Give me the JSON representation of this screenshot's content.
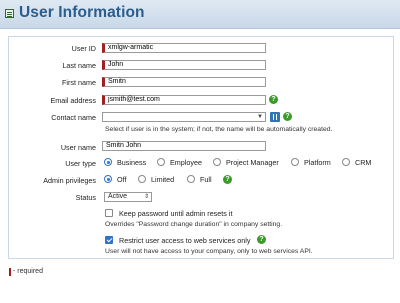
{
  "header": {
    "title": "User Information"
  },
  "form": {
    "user_id": {
      "label": "User ID",
      "value": "xmlgw-armatic"
    },
    "last_name": {
      "label": "Last name",
      "value": "John"
    },
    "first_name": {
      "label": "First name",
      "value": "Smitn"
    },
    "email": {
      "label": "Email address",
      "value": "jsmith@test.com"
    },
    "contact_name": {
      "label": "Contact name",
      "value": "",
      "note": "Select if user is in the system; if not, the name will be automatically created."
    },
    "user_name": {
      "label": "User name",
      "value": "Smitn John"
    },
    "user_type": {
      "label": "User type",
      "options": [
        "Business",
        "Employee",
        "Project Manager",
        "Platform",
        "CRM"
      ],
      "selected": "Business"
    },
    "admin_privileges": {
      "label": "Admin privileges",
      "options": [
        "Off",
        "Limited",
        "Full"
      ],
      "selected": "Off"
    },
    "status": {
      "label": "Status",
      "value": "Active"
    },
    "keep_password": {
      "label": "Keep password until admin resets it",
      "note": "Overrides \"Password change duration\" in company setting.",
      "checked": false
    },
    "restrict_access": {
      "label": "Restrict user access to web services only",
      "note": "User will not have access to your company, only to web services API.",
      "checked": true
    },
    "help_symbol": "?"
  },
  "footer": {
    "required_text": "- required"
  },
  "colors": {
    "accent": "#2a5d8f",
    "required": "#a02020",
    "help": "#3c9a2b",
    "selection": "#2f74c9"
  }
}
